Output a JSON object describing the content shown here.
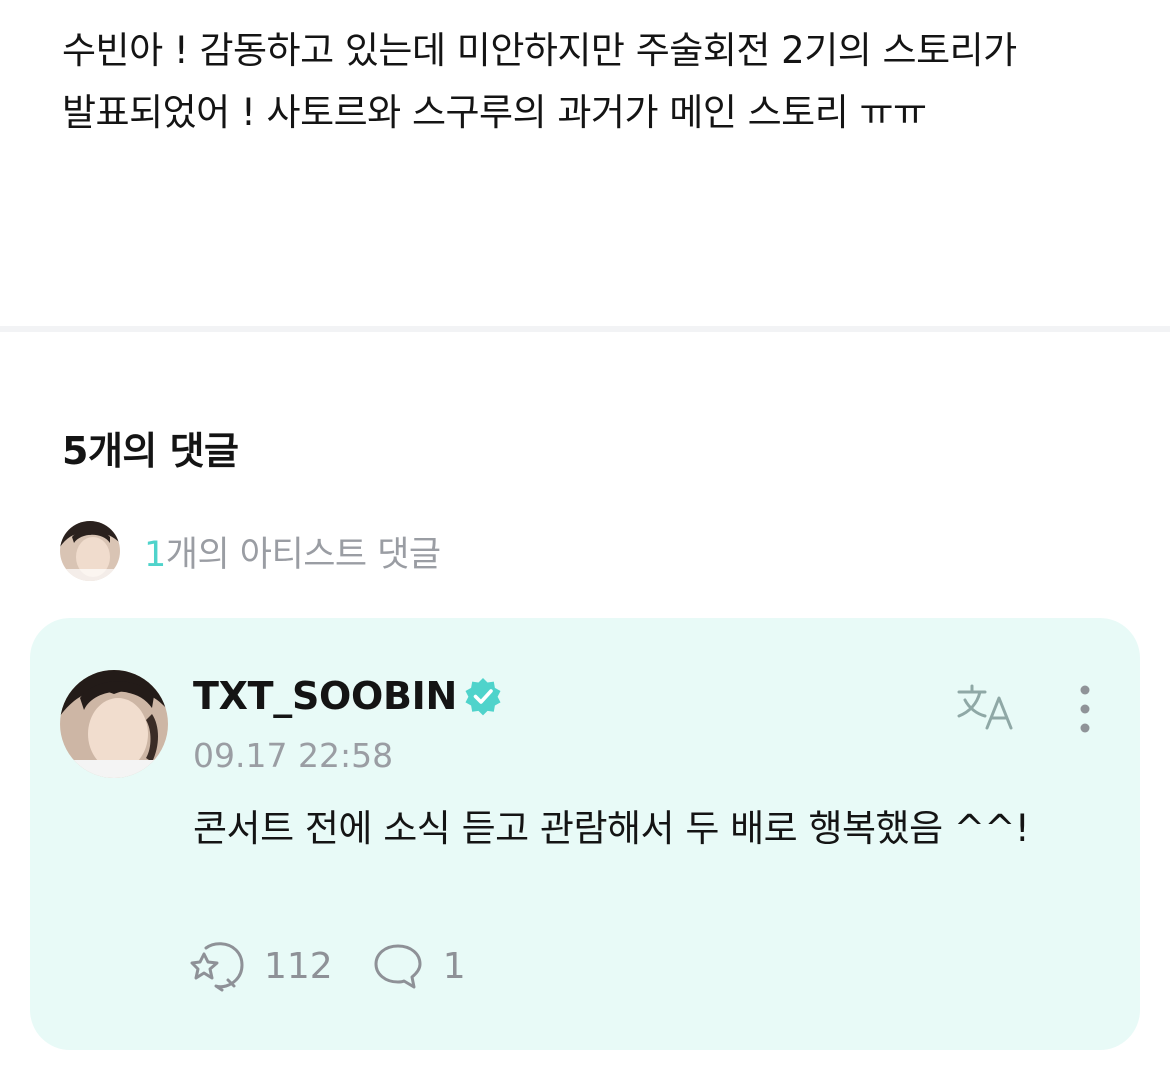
{
  "post": {
    "text": "수빈아 !  감동하고 있는데 미안하지만 주술회전 2기의 스토리가 발표되었어 ! 사토르와 스구루의 과거가 메인 스토리 ㅠㅠ"
  },
  "comments": {
    "title": "5개의 댓글",
    "artist_summary_count": "1",
    "artist_summary_suffix": "개의 아티스트 댓글"
  },
  "artist_comment": {
    "author": "TXT_SOOBIN",
    "timestamp": "09.17 22:58",
    "text": "콘서트 전에 소식 듣고 관람해서 두 배로 행복했음 ^^!",
    "like_count": "112",
    "reply_count": "1"
  },
  "icons": {
    "verified": "verified-badge-icon",
    "translate": "translate-icon",
    "more": "more-vertical-icon",
    "like": "like-icon",
    "reply": "reply-bubble-icon"
  },
  "colors": {
    "card_background": "#e8faf7",
    "accent": "#4fd3cb",
    "muted_text": "#9a9da3"
  }
}
